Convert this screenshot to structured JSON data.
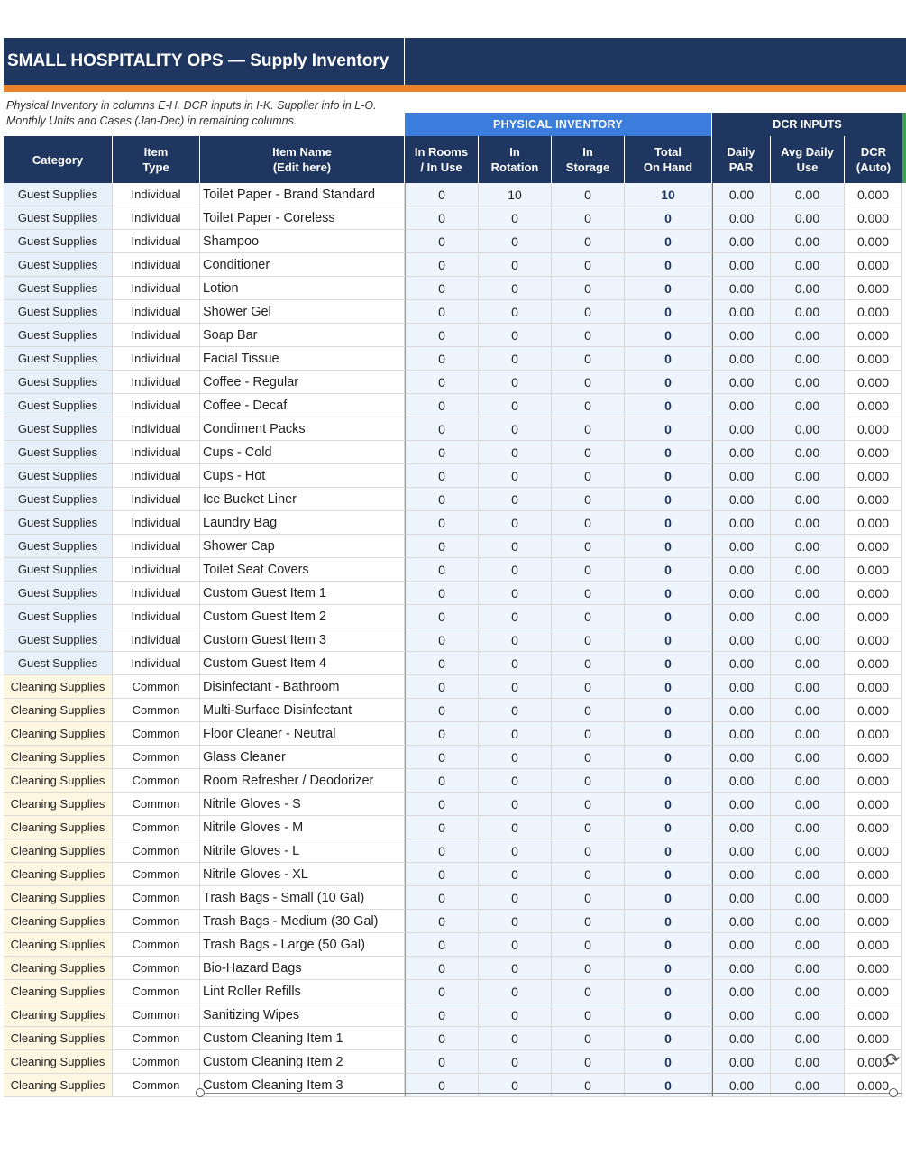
{
  "title": "SMALL HOSPITALITY OPS — Supply Inventory",
  "note_line1": "Physical Inventory in columns E-H. DCR inputs in I-K. Supplier info in L-O.",
  "note_line2": "Monthly Units and Cases (Jan-Dec) in remaining columns.",
  "groups": {
    "physical": "PHYSICAL INVENTORY",
    "dcr": "DCR INPUTS"
  },
  "headers": {
    "category": "Category",
    "item_type_1": "Item",
    "item_type_2": "Type",
    "item_name_1": "Item Name",
    "item_name_2": "(Edit here)",
    "in_rooms_1": "In Rooms",
    "in_rooms_2": "/ In Use",
    "in_rotation_1": "In",
    "in_rotation_2": "Rotation",
    "in_storage_1": "In",
    "in_storage_2": "Storage",
    "total_1": "Total",
    "total_2": "On Hand",
    "daily_par_1": "Daily",
    "daily_par_2": "PAR",
    "avg_use_1": "Avg Daily",
    "avg_use_2": "Use",
    "dcr_1": "DCR",
    "dcr_2": "(Auto)"
  },
  "rows": [
    {
      "category": "Guest Supplies",
      "type": "Individual",
      "name": "Toilet Paper - Brand Standard",
      "rooms": "0",
      "rotation": "10",
      "storage": "0",
      "total": "10",
      "par": "0.00",
      "avg": "0.00",
      "dcr": "0.000"
    },
    {
      "category": "Guest Supplies",
      "type": "Individual",
      "name": "Toilet Paper - Coreless",
      "rooms": "0",
      "rotation": "0",
      "storage": "0",
      "total": "0",
      "par": "0.00",
      "avg": "0.00",
      "dcr": "0.000"
    },
    {
      "category": "Guest Supplies",
      "type": "Individual",
      "name": "Shampoo",
      "rooms": "0",
      "rotation": "0",
      "storage": "0",
      "total": "0",
      "par": "0.00",
      "avg": "0.00",
      "dcr": "0.000"
    },
    {
      "category": "Guest Supplies",
      "type": "Individual",
      "name": "Conditioner",
      "rooms": "0",
      "rotation": "0",
      "storage": "0",
      "total": "0",
      "par": "0.00",
      "avg": "0.00",
      "dcr": "0.000"
    },
    {
      "category": "Guest Supplies",
      "type": "Individual",
      "name": "Lotion",
      "rooms": "0",
      "rotation": "0",
      "storage": "0",
      "total": "0",
      "par": "0.00",
      "avg": "0.00",
      "dcr": "0.000"
    },
    {
      "category": "Guest Supplies",
      "type": "Individual",
      "name": "Shower Gel",
      "rooms": "0",
      "rotation": "0",
      "storage": "0",
      "total": "0",
      "par": "0.00",
      "avg": "0.00",
      "dcr": "0.000"
    },
    {
      "category": "Guest Supplies",
      "type": "Individual",
      "name": "Soap Bar",
      "rooms": "0",
      "rotation": "0",
      "storage": "0",
      "total": "0",
      "par": "0.00",
      "avg": "0.00",
      "dcr": "0.000"
    },
    {
      "category": "Guest Supplies",
      "type": "Individual",
      "name": "Facial Tissue",
      "rooms": "0",
      "rotation": "0",
      "storage": "0",
      "total": "0",
      "par": "0.00",
      "avg": "0.00",
      "dcr": "0.000"
    },
    {
      "category": "Guest Supplies",
      "type": "Individual",
      "name": "Coffee - Regular",
      "rooms": "0",
      "rotation": "0",
      "storage": "0",
      "total": "0",
      "par": "0.00",
      "avg": "0.00",
      "dcr": "0.000"
    },
    {
      "category": "Guest Supplies",
      "type": "Individual",
      "name": "Coffee - Decaf",
      "rooms": "0",
      "rotation": "0",
      "storage": "0",
      "total": "0",
      "par": "0.00",
      "avg": "0.00",
      "dcr": "0.000"
    },
    {
      "category": "Guest Supplies",
      "type": "Individual",
      "name": "Condiment Packs",
      "rooms": "0",
      "rotation": "0",
      "storage": "0",
      "total": "0",
      "par": "0.00",
      "avg": "0.00",
      "dcr": "0.000"
    },
    {
      "category": "Guest Supplies",
      "type": "Individual",
      "name": "Cups - Cold",
      "rooms": "0",
      "rotation": "0",
      "storage": "0",
      "total": "0",
      "par": "0.00",
      "avg": "0.00",
      "dcr": "0.000"
    },
    {
      "category": "Guest Supplies",
      "type": "Individual",
      "name": "Cups - Hot",
      "rooms": "0",
      "rotation": "0",
      "storage": "0",
      "total": "0",
      "par": "0.00",
      "avg": "0.00",
      "dcr": "0.000"
    },
    {
      "category": "Guest Supplies",
      "type": "Individual",
      "name": "Ice Bucket Liner",
      "rooms": "0",
      "rotation": "0",
      "storage": "0",
      "total": "0",
      "par": "0.00",
      "avg": "0.00",
      "dcr": "0.000"
    },
    {
      "category": "Guest Supplies",
      "type": "Individual",
      "name": "Laundry Bag",
      "rooms": "0",
      "rotation": "0",
      "storage": "0",
      "total": "0",
      "par": "0.00",
      "avg": "0.00",
      "dcr": "0.000"
    },
    {
      "category": "Guest Supplies",
      "type": "Individual",
      "name": "Shower Cap",
      "rooms": "0",
      "rotation": "0",
      "storage": "0",
      "total": "0",
      "par": "0.00",
      "avg": "0.00",
      "dcr": "0.000"
    },
    {
      "category": "Guest Supplies",
      "type": "Individual",
      "name": "Toilet Seat Covers",
      "rooms": "0",
      "rotation": "0",
      "storage": "0",
      "total": "0",
      "par": "0.00",
      "avg": "0.00",
      "dcr": "0.000"
    },
    {
      "category": "Guest Supplies",
      "type": "Individual",
      "name": "Custom Guest Item 1",
      "rooms": "0",
      "rotation": "0",
      "storage": "0",
      "total": "0",
      "par": "0.00",
      "avg": "0.00",
      "dcr": "0.000"
    },
    {
      "category": "Guest Supplies",
      "type": "Individual",
      "name": "Custom Guest Item 2",
      "rooms": "0",
      "rotation": "0",
      "storage": "0",
      "total": "0",
      "par": "0.00",
      "avg": "0.00",
      "dcr": "0.000"
    },
    {
      "category": "Guest Supplies",
      "type": "Individual",
      "name": "Custom Guest Item 3",
      "rooms": "0",
      "rotation": "0",
      "storage": "0",
      "total": "0",
      "par": "0.00",
      "avg": "0.00",
      "dcr": "0.000"
    },
    {
      "category": "Guest Supplies",
      "type": "Individual",
      "name": "Custom Guest Item 4",
      "rooms": "0",
      "rotation": "0",
      "storage": "0",
      "total": "0",
      "par": "0.00",
      "avg": "0.00",
      "dcr": "0.000"
    },
    {
      "category": "Cleaning Supplies",
      "type": "Common",
      "name": "Disinfectant - Bathroom",
      "rooms": "0",
      "rotation": "0",
      "storage": "0",
      "total": "0",
      "par": "0.00",
      "avg": "0.00",
      "dcr": "0.000"
    },
    {
      "category": "Cleaning Supplies",
      "type": "Common",
      "name": "Multi-Surface Disinfectant",
      "rooms": "0",
      "rotation": "0",
      "storage": "0",
      "total": "0",
      "par": "0.00",
      "avg": "0.00",
      "dcr": "0.000"
    },
    {
      "category": "Cleaning Supplies",
      "type": "Common",
      "name": "Floor Cleaner - Neutral",
      "rooms": "0",
      "rotation": "0",
      "storage": "0",
      "total": "0",
      "par": "0.00",
      "avg": "0.00",
      "dcr": "0.000"
    },
    {
      "category": "Cleaning Supplies",
      "type": "Common",
      "name": "Glass Cleaner",
      "rooms": "0",
      "rotation": "0",
      "storage": "0",
      "total": "0",
      "par": "0.00",
      "avg": "0.00",
      "dcr": "0.000"
    },
    {
      "category": "Cleaning Supplies",
      "type": "Common",
      "name": "Room Refresher / Deodorizer",
      "rooms": "0",
      "rotation": "0",
      "storage": "0",
      "total": "0",
      "par": "0.00",
      "avg": "0.00",
      "dcr": "0.000"
    },
    {
      "category": "Cleaning Supplies",
      "type": "Common",
      "name": "Nitrile Gloves - S",
      "rooms": "0",
      "rotation": "0",
      "storage": "0",
      "total": "0",
      "par": "0.00",
      "avg": "0.00",
      "dcr": "0.000"
    },
    {
      "category": "Cleaning Supplies",
      "type": "Common",
      "name": "Nitrile Gloves - M",
      "rooms": "0",
      "rotation": "0",
      "storage": "0",
      "total": "0",
      "par": "0.00",
      "avg": "0.00",
      "dcr": "0.000"
    },
    {
      "category": "Cleaning Supplies",
      "type": "Common",
      "name": "Nitrile Gloves - L",
      "rooms": "0",
      "rotation": "0",
      "storage": "0",
      "total": "0",
      "par": "0.00",
      "avg": "0.00",
      "dcr": "0.000"
    },
    {
      "category": "Cleaning Supplies",
      "type": "Common",
      "name": "Nitrile Gloves - XL",
      "rooms": "0",
      "rotation": "0",
      "storage": "0",
      "total": "0",
      "par": "0.00",
      "avg": "0.00",
      "dcr": "0.000"
    },
    {
      "category": "Cleaning Supplies",
      "type": "Common",
      "name": "Trash Bags - Small (10 Gal)",
      "rooms": "0",
      "rotation": "0",
      "storage": "0",
      "total": "0",
      "par": "0.00",
      "avg": "0.00",
      "dcr": "0.000"
    },
    {
      "category": "Cleaning Supplies",
      "type": "Common",
      "name": "Trash Bags - Medium (30 Gal)",
      "rooms": "0",
      "rotation": "0",
      "storage": "0",
      "total": "0",
      "par": "0.00",
      "avg": "0.00",
      "dcr": "0.000"
    },
    {
      "category": "Cleaning Supplies",
      "type": "Common",
      "name": "Trash Bags - Large (50 Gal)",
      "rooms": "0",
      "rotation": "0",
      "storage": "0",
      "total": "0",
      "par": "0.00",
      "avg": "0.00",
      "dcr": "0.000"
    },
    {
      "category": "Cleaning Supplies",
      "type": "Common",
      "name": "Bio-Hazard Bags",
      "rooms": "0",
      "rotation": "0",
      "storage": "0",
      "total": "0",
      "par": "0.00",
      "avg": "0.00",
      "dcr": "0.000"
    },
    {
      "category": "Cleaning Supplies",
      "type": "Common",
      "name": "Lint Roller Refills",
      "rooms": "0",
      "rotation": "0",
      "storage": "0",
      "total": "0",
      "par": "0.00",
      "avg": "0.00",
      "dcr": "0.000"
    },
    {
      "category": "Cleaning Supplies",
      "type": "Common",
      "name": "Sanitizing Wipes",
      "rooms": "0",
      "rotation": "0",
      "storage": "0",
      "total": "0",
      "par": "0.00",
      "avg": "0.00",
      "dcr": "0.000"
    },
    {
      "category": "Cleaning Supplies",
      "type": "Common",
      "name": "Custom Cleaning Item 1",
      "rooms": "0",
      "rotation": "0",
      "storage": "0",
      "total": "0",
      "par": "0.00",
      "avg": "0.00",
      "dcr": "0.000"
    },
    {
      "category": "Cleaning Supplies",
      "type": "Common",
      "name": "Custom Cleaning Item 2",
      "rooms": "0",
      "rotation": "0",
      "storage": "0",
      "total": "0",
      "par": "0.00",
      "avg": "0.00",
      "dcr": "0.000"
    },
    {
      "category": "Cleaning Supplies",
      "type": "Common",
      "name": "Custom Cleaning Item 3",
      "rooms": "0",
      "rotation": "0",
      "storage": "0",
      "total": "0",
      "par": "0.00",
      "avg": "0.00",
      "dcr": "0.000"
    }
  ],
  "colors": {
    "header_navy": "#1f3660",
    "header_blue": "#3b7ddd",
    "accent_orange": "#e8812c",
    "accent_green": "#3aa24a",
    "guest_fill": "#e6f0fb",
    "cleaning_fill": "#fdf6e0"
  },
  "icons": {
    "rotate_handle": "rotate-icon",
    "selection_handle": "resize-handle-icon"
  }
}
